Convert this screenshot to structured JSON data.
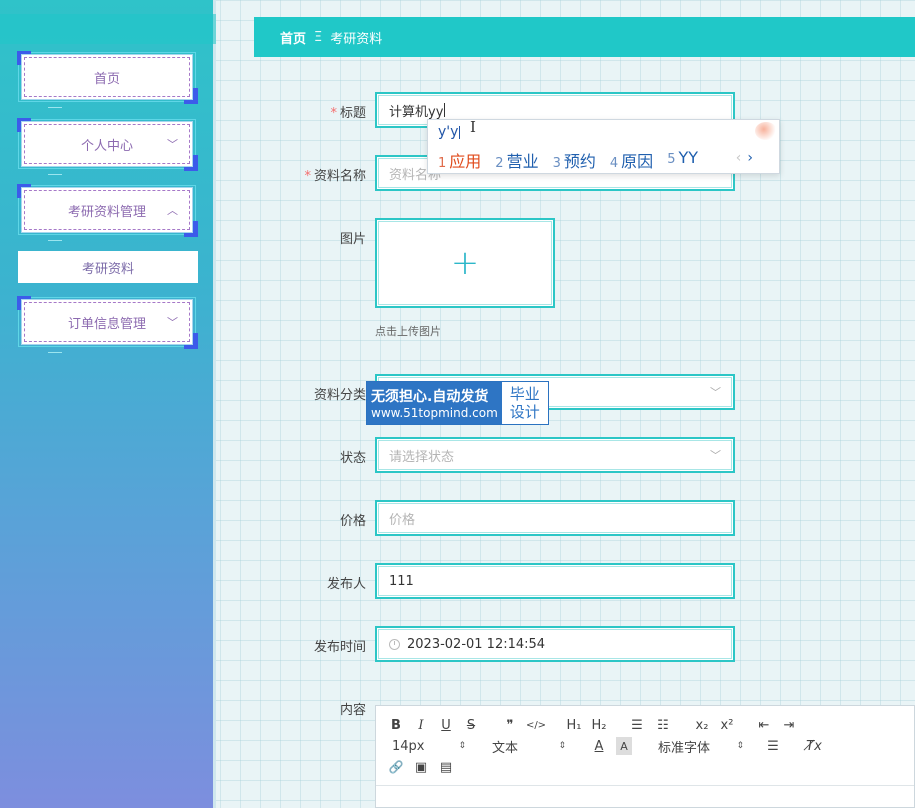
{
  "sidebar": {
    "items": [
      {
        "label": "首页"
      },
      {
        "label": "个人中心",
        "arrow": "﹀"
      },
      {
        "label": "考研资料管理",
        "arrow": "︿"
      },
      {
        "label": "订单信息管理",
        "arrow": "﹀"
      }
    ],
    "subitem": {
      "label": "考研资料"
    }
  },
  "breadcrumb": {
    "home": "首页",
    "separator": "Ξ",
    "current": "考研资料"
  },
  "form": {
    "title": {
      "label": "标题",
      "required": "*",
      "value": "计算机yy"
    },
    "material_name": {
      "label": "资料名称",
      "required": "*",
      "placeholder": "资料名称"
    },
    "image": {
      "label": "图片",
      "plus": "+",
      "tip": "点击上传图片"
    },
    "category": {
      "label": "资料分类",
      "chevron": "﹀"
    },
    "status": {
      "label": "状态",
      "placeholder": "请选择状态",
      "chevron": "﹀"
    },
    "price": {
      "label": "价格",
      "placeholder": "价格"
    },
    "publisher": {
      "label": "发布人",
      "value": "111"
    },
    "publish_time": {
      "label": "发布时间",
      "value": "2023-02-01 12:14:54"
    },
    "content": {
      "label": "内容"
    }
  },
  "ime": {
    "pinyin": "y'y",
    "candidates": [
      {
        "n": "1",
        "text": "应用"
      },
      {
        "n": "2",
        "text": "营业"
      },
      {
        "n": "3",
        "text": "预约"
      },
      {
        "n": "4",
        "text": "原因"
      },
      {
        "n": "5",
        "text": "YY"
      }
    ],
    "prev": "‹",
    "next": "›"
  },
  "watermark": {
    "line1": "无须担心.自动发货",
    "line2": "www.51topmind.com",
    "right1": "毕业",
    "right2": "设计"
  },
  "editor": {
    "bold": "B",
    "italic": "I",
    "underline": "U",
    "strike": "S",
    "blockquote": "❞",
    "code": "</>",
    "h1": "H₁",
    "h2": "H₂",
    "ordered_list": "☰",
    "bullet_list": "☷",
    "subscript": "x₂",
    "superscript": "x²",
    "outdent": "⇤",
    "indent": "⇥",
    "font_size": "14px",
    "header": "文本",
    "font_color": "A",
    "background": "A",
    "font_family": "标准字体",
    "align": "☰",
    "clean": "T̸x",
    "link": "🔗",
    "image": "▣",
    "video": "▤",
    "spinner": "⇕"
  },
  "ibeam": "I"
}
